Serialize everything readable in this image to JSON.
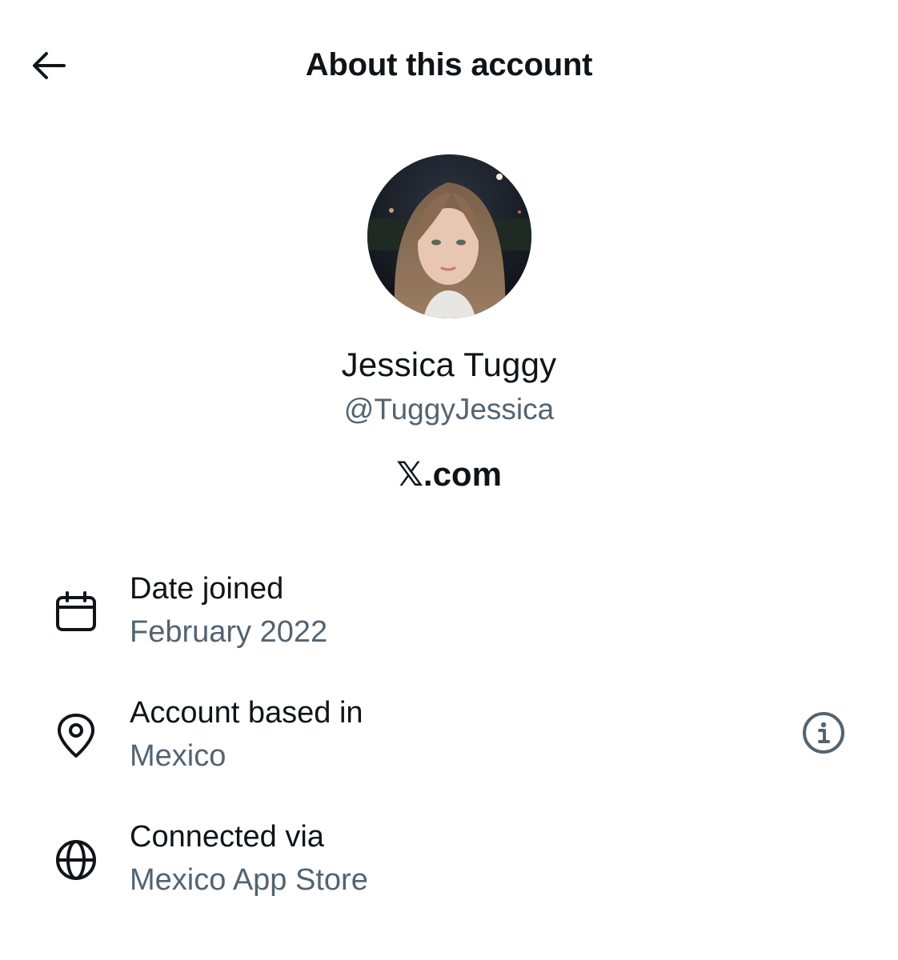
{
  "header": {
    "title": "About this account",
    "back_icon": "arrow-left-icon"
  },
  "profile": {
    "display_name": "Jessica Tuggy",
    "handle": "@TuggyJessica",
    "platform": "𝕏.com"
  },
  "details": [
    {
      "label": "Date joined",
      "value": "February 2022",
      "icon": "calendar-icon"
    },
    {
      "label": "Account based in",
      "value": "Mexico",
      "icon": "location-pin-icon",
      "info_icon": "info-icon"
    },
    {
      "label": "Connected via",
      "value": "Mexico App Store",
      "icon": "globe-icon"
    }
  ],
  "colors": {
    "text_primary": "#0f1419",
    "text_secondary": "#536471",
    "background": "#ffffff"
  }
}
